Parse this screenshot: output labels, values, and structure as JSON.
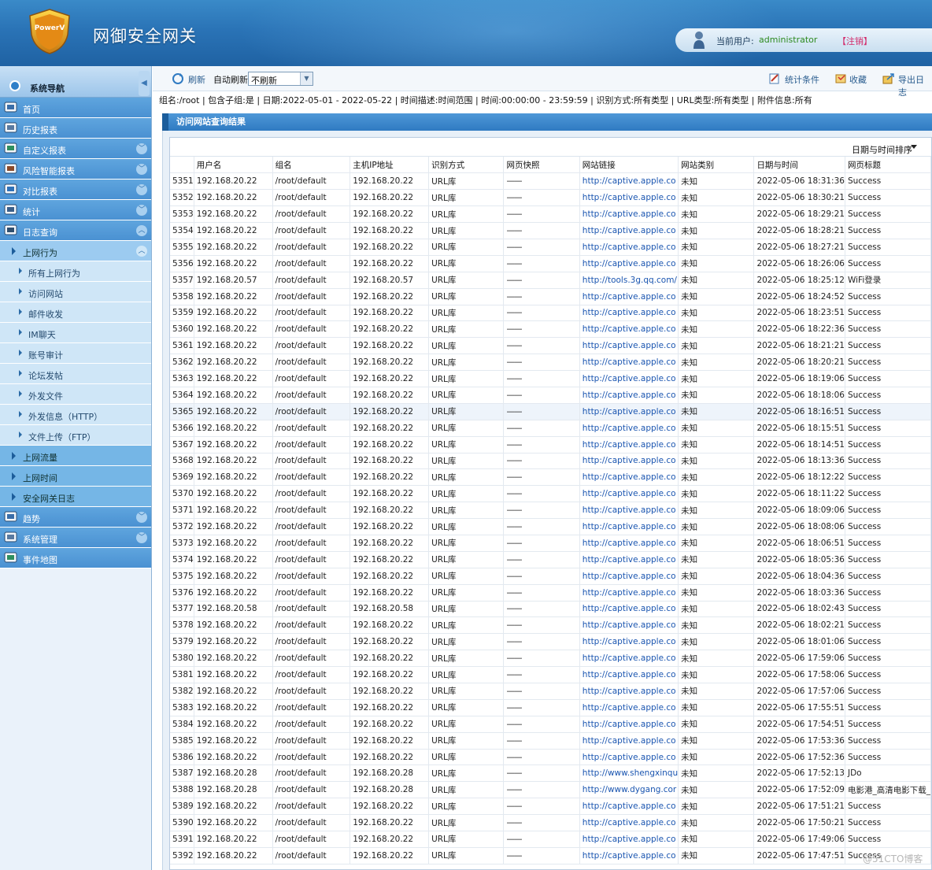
{
  "header": {
    "logo_text": "PowerV",
    "title": "网御安全网关",
    "user_label": "当前用户:",
    "user_name": "administrator",
    "logout": "【注销】"
  },
  "sidebar": {
    "nav_title": "系统导航",
    "items": [
      {
        "label": "首页",
        "icon": "home-icon",
        "chevron": false
      },
      {
        "label": "历史报表",
        "icon": "history-report-icon",
        "chevron": false
      },
      {
        "label": "自定义报表",
        "icon": "custom-report-icon",
        "chevron": true
      },
      {
        "label": "风险智能报表",
        "icon": "risk-report-icon",
        "chevron": true
      },
      {
        "label": "对比报表",
        "icon": "compare-report-icon",
        "chevron": true
      },
      {
        "label": "统计",
        "icon": "stats-icon",
        "chevron": true
      },
      {
        "label": "日志查询",
        "icon": "log-query-icon",
        "chevron": true,
        "expanded": true
      }
    ],
    "sub_active": "上网行为",
    "leaves": [
      "所有上网行为",
      "访问网站",
      "邮件收发",
      "IM聊天",
      "账号审计",
      "论坛发帖",
      "外发文件",
      "外发信息（HTTP）",
      "文件上传（FTP）"
    ],
    "subs": [
      "上网流量",
      "上网时间",
      "安全网关日志"
    ],
    "bottom_items": [
      {
        "label": "趋势",
        "icon": "trend-icon",
        "chevron": true
      },
      {
        "label": "系统管理",
        "icon": "system-admin-icon",
        "chevron": true
      },
      {
        "label": "事件地图",
        "icon": "event-map-icon",
        "chevron": false
      }
    ]
  },
  "toolbar": {
    "refresh": "刷新",
    "auto_refresh_label": "自动刷新",
    "auto_refresh_value": "不刷新",
    "stats_condition": "统计条件",
    "favorite": "收藏",
    "export_log": "导出日志"
  },
  "filter_line": "组名:/root | 包含子组:是 | 日期:2022-05-01 - 2022-05-22 | 时间描述:时间范围 | 时间:00:00:00 - 23:59:59 | 识别方式:所有类型 | URL类型:所有类型 | 附件信息:所有",
  "results": {
    "title": "访问网站查询结果",
    "sort_label": "日期与时间排序",
    "columns": [
      "",
      "用户名",
      "组名",
      "主机IP地址",
      "识别方式",
      "网页快照",
      "网站链接",
      "网站类别",
      "日期与时间",
      "网页标题"
    ],
    "rows": [
      [
        "5351",
        "192.168.20.22",
        "/root/default",
        "192.168.20.22",
        "URL库",
        "——",
        "http://captive.apple.co",
        "未知",
        "2022-05-06 18:31:36",
        "Success"
      ],
      [
        "5352",
        "192.168.20.22",
        "/root/default",
        "192.168.20.22",
        "URL库",
        "——",
        "http://captive.apple.co",
        "未知",
        "2022-05-06 18:30:21",
        "Success"
      ],
      [
        "5353",
        "192.168.20.22",
        "/root/default",
        "192.168.20.22",
        "URL库",
        "——",
        "http://captive.apple.co",
        "未知",
        "2022-05-06 18:29:21",
        "Success"
      ],
      [
        "5354",
        "192.168.20.22",
        "/root/default",
        "192.168.20.22",
        "URL库",
        "——",
        "http://captive.apple.co",
        "未知",
        "2022-05-06 18:28:21",
        "Success"
      ],
      [
        "5355",
        "192.168.20.22",
        "/root/default",
        "192.168.20.22",
        "URL库",
        "——",
        "http://captive.apple.co",
        "未知",
        "2022-05-06 18:27:21",
        "Success"
      ],
      [
        "5356",
        "192.168.20.22",
        "/root/default",
        "192.168.20.22",
        "URL库",
        "——",
        "http://captive.apple.co",
        "未知",
        "2022-05-06 18:26:06",
        "Success"
      ],
      [
        "5357",
        "192.168.20.57",
        "/root/default",
        "192.168.20.57",
        "URL库",
        "——",
        "http://tools.3g.qq.com/",
        "未知",
        "2022-05-06 18:25:12",
        "WiFi登录"
      ],
      [
        "5358",
        "192.168.20.22",
        "/root/default",
        "192.168.20.22",
        "URL库",
        "——",
        "http://captive.apple.co",
        "未知",
        "2022-05-06 18:24:52",
        "Success"
      ],
      [
        "5359",
        "192.168.20.22",
        "/root/default",
        "192.168.20.22",
        "URL库",
        "——",
        "http://captive.apple.co",
        "未知",
        "2022-05-06 18:23:51",
        "Success"
      ],
      [
        "5360",
        "192.168.20.22",
        "/root/default",
        "192.168.20.22",
        "URL库",
        "——",
        "http://captive.apple.co",
        "未知",
        "2022-05-06 18:22:36",
        "Success"
      ],
      [
        "5361",
        "192.168.20.22",
        "/root/default",
        "192.168.20.22",
        "URL库",
        "——",
        "http://captive.apple.co",
        "未知",
        "2022-05-06 18:21:21",
        "Success"
      ],
      [
        "5362",
        "192.168.20.22",
        "/root/default",
        "192.168.20.22",
        "URL库",
        "——",
        "http://captive.apple.co",
        "未知",
        "2022-05-06 18:20:21",
        "Success"
      ],
      [
        "5363",
        "192.168.20.22",
        "/root/default",
        "192.168.20.22",
        "URL库",
        "——",
        "http://captive.apple.co",
        "未知",
        "2022-05-06 18:19:06",
        "Success"
      ],
      [
        "5364",
        "192.168.20.22",
        "/root/default",
        "192.168.20.22",
        "URL库",
        "——",
        "http://captive.apple.co",
        "未知",
        "2022-05-06 18:18:06",
        "Success"
      ],
      [
        "5365",
        "192.168.20.22",
        "/root/default",
        "192.168.20.22",
        "URL库",
        "——",
        "http://captive.apple.co",
        "未知",
        "2022-05-06 18:16:51",
        "Success"
      ],
      [
        "5366",
        "192.168.20.22",
        "/root/default",
        "192.168.20.22",
        "URL库",
        "——",
        "http://captive.apple.co",
        "未知",
        "2022-05-06 18:15:51",
        "Success"
      ],
      [
        "5367",
        "192.168.20.22",
        "/root/default",
        "192.168.20.22",
        "URL库",
        "——",
        "http://captive.apple.co",
        "未知",
        "2022-05-06 18:14:51",
        "Success"
      ],
      [
        "5368",
        "192.168.20.22",
        "/root/default",
        "192.168.20.22",
        "URL库",
        "——",
        "http://captive.apple.co",
        "未知",
        "2022-05-06 18:13:36",
        "Success"
      ],
      [
        "5369",
        "192.168.20.22",
        "/root/default",
        "192.168.20.22",
        "URL库",
        "——",
        "http://captive.apple.co",
        "未知",
        "2022-05-06 18:12:22",
        "Success"
      ],
      [
        "5370",
        "192.168.20.22",
        "/root/default",
        "192.168.20.22",
        "URL库",
        "——",
        "http://captive.apple.co",
        "未知",
        "2022-05-06 18:11:22",
        "Success"
      ],
      [
        "5371",
        "192.168.20.22",
        "/root/default",
        "192.168.20.22",
        "URL库",
        "——",
        "http://captive.apple.co",
        "未知",
        "2022-05-06 18:09:06",
        "Success"
      ],
      [
        "5372",
        "192.168.20.22",
        "/root/default",
        "192.168.20.22",
        "URL库",
        "——",
        "http://captive.apple.co",
        "未知",
        "2022-05-06 18:08:06",
        "Success"
      ],
      [
        "5373",
        "192.168.20.22",
        "/root/default",
        "192.168.20.22",
        "URL库",
        "——",
        "http://captive.apple.co",
        "未知",
        "2022-05-06 18:06:51",
        "Success"
      ],
      [
        "5374",
        "192.168.20.22",
        "/root/default",
        "192.168.20.22",
        "URL库",
        "——",
        "http://captive.apple.co",
        "未知",
        "2022-05-06 18:05:36",
        "Success"
      ],
      [
        "5375",
        "192.168.20.22",
        "/root/default",
        "192.168.20.22",
        "URL库",
        "——",
        "http://captive.apple.co",
        "未知",
        "2022-05-06 18:04:36",
        "Success"
      ],
      [
        "5376",
        "192.168.20.22",
        "/root/default",
        "192.168.20.22",
        "URL库",
        "——",
        "http://captive.apple.co",
        "未知",
        "2022-05-06 18:03:36",
        "Success"
      ],
      [
        "5377",
        "192.168.20.58",
        "/root/default",
        "192.168.20.58",
        "URL库",
        "——",
        "http://captive.apple.co",
        "未知",
        "2022-05-06 18:02:43",
        "Success"
      ],
      [
        "5378",
        "192.168.20.22",
        "/root/default",
        "192.168.20.22",
        "URL库",
        "——",
        "http://captive.apple.co",
        "未知",
        "2022-05-06 18:02:21",
        "Success"
      ],
      [
        "5379",
        "192.168.20.22",
        "/root/default",
        "192.168.20.22",
        "URL库",
        "——",
        "http://captive.apple.co",
        "未知",
        "2022-05-06 18:01:06",
        "Success"
      ],
      [
        "5380",
        "192.168.20.22",
        "/root/default",
        "192.168.20.22",
        "URL库",
        "——",
        "http://captive.apple.co",
        "未知",
        "2022-05-06 17:59:06",
        "Success"
      ],
      [
        "5381",
        "192.168.20.22",
        "/root/default",
        "192.168.20.22",
        "URL库",
        "——",
        "http://captive.apple.co",
        "未知",
        "2022-05-06 17:58:06",
        "Success"
      ],
      [
        "5382",
        "192.168.20.22",
        "/root/default",
        "192.168.20.22",
        "URL库",
        "——",
        "http://captive.apple.co",
        "未知",
        "2022-05-06 17:57:06",
        "Success"
      ],
      [
        "5383",
        "192.168.20.22",
        "/root/default",
        "192.168.20.22",
        "URL库",
        "——",
        "http://captive.apple.co",
        "未知",
        "2022-05-06 17:55:51",
        "Success"
      ],
      [
        "5384",
        "192.168.20.22",
        "/root/default",
        "192.168.20.22",
        "URL库",
        "——",
        "http://captive.apple.co",
        "未知",
        "2022-05-06 17:54:51",
        "Success"
      ],
      [
        "5385",
        "192.168.20.22",
        "/root/default",
        "192.168.20.22",
        "URL库",
        "——",
        "http://captive.apple.co",
        "未知",
        "2022-05-06 17:53:36",
        "Success"
      ],
      [
        "5386",
        "192.168.20.22",
        "/root/default",
        "192.168.20.22",
        "URL库",
        "——",
        "http://captive.apple.co",
        "未知",
        "2022-05-06 17:52:36",
        "Success"
      ],
      [
        "5387",
        "192.168.20.28",
        "/root/default",
        "192.168.20.28",
        "URL库",
        "——",
        "http://www.shengxinqu",
        "未知",
        "2022-05-06 17:52:13",
        "JDo"
      ],
      [
        "5388",
        "192.168.20.28",
        "/root/default",
        "192.168.20.28",
        "URL库",
        "——",
        "http://www.dygang.cor",
        "未知",
        "2022-05-06 17:52:09",
        "电影港_高清电影下载_"
      ],
      [
        "5389",
        "192.168.20.22",
        "/root/default",
        "192.168.20.22",
        "URL库",
        "——",
        "http://captive.apple.co",
        "未知",
        "2022-05-06 17:51:21",
        "Success"
      ],
      [
        "5390",
        "192.168.20.22",
        "/root/default",
        "192.168.20.22",
        "URL库",
        "——",
        "http://captive.apple.co",
        "未知",
        "2022-05-06 17:50:21",
        "Success"
      ],
      [
        "5391",
        "192.168.20.22",
        "/root/default",
        "192.168.20.22",
        "URL库",
        "——",
        "http://captive.apple.co",
        "未知",
        "2022-05-06 17:49:06",
        "Success"
      ],
      [
        "5392",
        "192.168.20.22",
        "/root/default",
        "192.168.20.22",
        "URL库",
        "——",
        "http://captive.apple.co",
        "未知",
        "2022-05-06 17:47:51",
        "Success"
      ]
    ],
    "highlight_row": "5365"
  },
  "watermark": "@51CTO博客",
  "colors": {
    "header_blue": "#2a73b6",
    "nav_blue": "#4a91d2",
    "link_blue": "#1a55b0",
    "logout_pink": "#d32a6a",
    "user_green": "#2d8a1f"
  }
}
